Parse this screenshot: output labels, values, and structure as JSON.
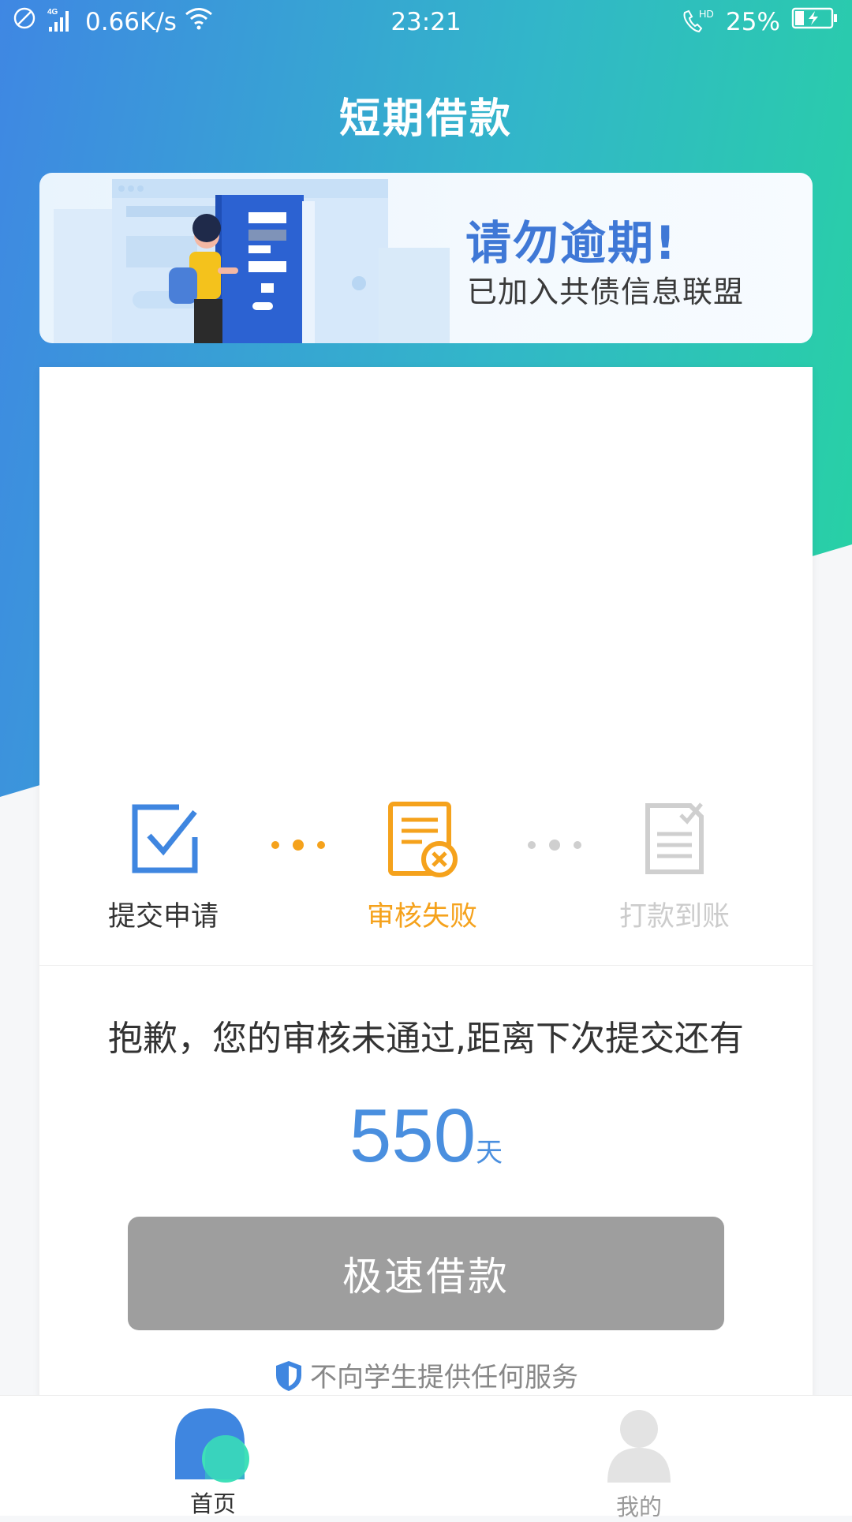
{
  "status_bar": {
    "net_speed": "0.66K/s",
    "network_type": "4G",
    "time": "23:21",
    "call_badge": "HD",
    "battery_percent": "25%",
    "battery_level": 0.25,
    "icons": [
      "no-sim-icon",
      "signal-icon",
      "wifi-icon",
      "hd-call-icon",
      "battery-charging-icon"
    ]
  },
  "header": {
    "title": "短期借款"
  },
  "banner": {
    "headline": "请勿逾期!",
    "subtitle": "已加入共债信息联盟"
  },
  "steps": [
    {
      "label": "提交申请",
      "icon": "checkbox-icon",
      "state": "done",
      "color": "#3f86e0"
    },
    {
      "label": "审核失败",
      "icon": "document-rejected-icon",
      "state": "failed",
      "color": "#f5a21c"
    },
    {
      "label": "打款到账",
      "icon": "document-check-icon",
      "state": "pending",
      "color": "#cccccc"
    }
  ],
  "result": {
    "message": "抱歉，您的审核未通过,距离下次提交还有",
    "days": "550",
    "unit": "天"
  },
  "action": {
    "button_label": "极速借款"
  },
  "notice": {
    "text": "不向学生提供任何服务",
    "icon": "shield-icon"
  },
  "bottom_nav": [
    {
      "label": "首页",
      "icon": "home-icon",
      "active": true
    },
    {
      "label": "我的",
      "icon": "user-icon",
      "active": false
    }
  ],
  "colors": {
    "gradient_start": "#3f87e3",
    "gradient_end": "#27d3a2",
    "accent_blue": "#4a8fdf",
    "accent_orange": "#f5a21c",
    "button_disabled": "#9e9e9e"
  }
}
